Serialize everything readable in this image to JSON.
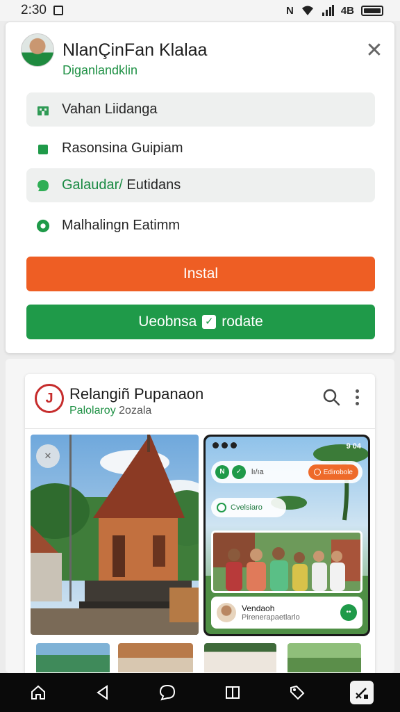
{
  "status_bar": {
    "time": "2:30",
    "signal_text": "4B",
    "icons": [
      "screenshot-icon",
      "nfc-icon",
      "wifi-icon",
      "signal-icon",
      "battery-icon"
    ]
  },
  "install_card": {
    "app_name": "NlanÇinFan  Klalaa",
    "developer": "Diganlandklin",
    "menu_items": [
      {
        "label": "Vahan Liidanga",
        "icon": "building-icon",
        "accent": ""
      },
      {
        "label": "Rasonsina Guipiam",
        "icon": "person-icon",
        "accent": ""
      },
      {
        "label": " Eutidans",
        "icon": "chat-icon",
        "accent": "Galaudar/"
      },
      {
        "label": "Malhalingn Eatimm",
        "icon": "location-icon",
        "accent": ""
      }
    ],
    "install_label": "Instal",
    "update_label_left": "Ueobnsa",
    "update_label_right": "rodate",
    "colors": {
      "install": "#ee5e24",
      "update": "#1f9a49",
      "accent_text": "#1f9145"
    }
  },
  "feed_card": {
    "title": "Relangiñ Pupanaon",
    "subtitle_accent": "Palolaroy",
    "subtitle_rest": " 2ozala",
    "phone_mock": {
      "status_left": "9 04",
      "pill_text": "lı/ıa",
      "orange_pill": "Edirobole",
      "tag": "Cvelsiaro",
      "person_name": "Vendaoh",
      "person_sub": "Pirenerapaetlarlo"
    }
  },
  "nav_bar": {
    "icons": [
      "home-icon",
      "back-icon",
      "chat-bubble-icon",
      "book-icon",
      "tag-icon",
      "edit-image-icon"
    ]
  }
}
